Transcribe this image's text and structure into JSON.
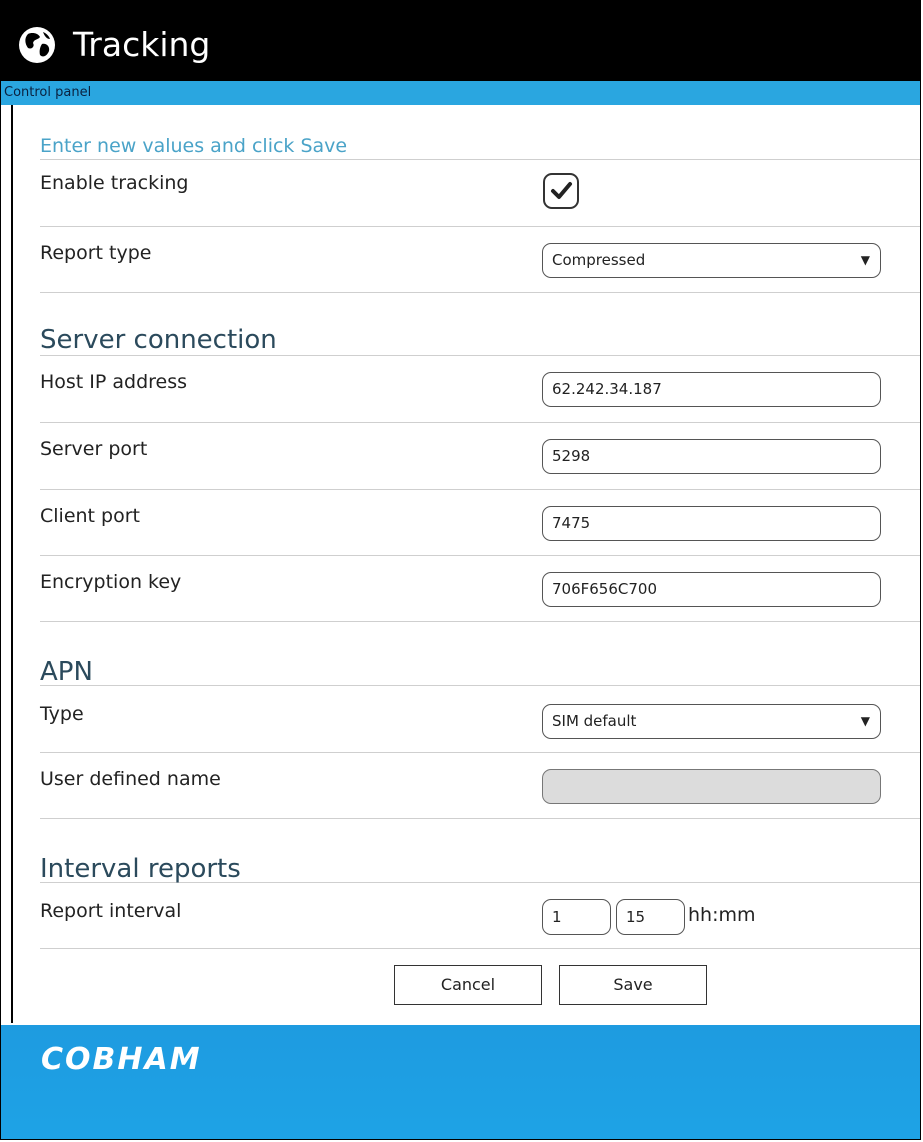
{
  "header": {
    "title": "Tracking",
    "icon": "globe-icon"
  },
  "breadcrumb": "Control panel",
  "form": {
    "intro": "Enter new values and click Save",
    "enable_tracking": {
      "label": "Enable tracking",
      "checked": true
    },
    "report_type": {
      "label": "Report type",
      "value": "Compressed"
    },
    "server_section": "Server connection",
    "host_ip": {
      "label": "Host IP address",
      "value": "62.242.34.187"
    },
    "server_port": {
      "label": "Server port",
      "value": "5298"
    },
    "client_port": {
      "label": "Client port",
      "value": "7475"
    },
    "encryption_key": {
      "label": "Encryption key",
      "value": "706F656C700"
    },
    "apn_section": "APN",
    "apn_type": {
      "label": "Type",
      "value": "SIM default"
    },
    "user_defined_name": {
      "label": "User defined name",
      "value": ""
    },
    "interval_section": "Interval reports",
    "report_interval": {
      "label": "Report interval",
      "hours": "1",
      "minutes": "15",
      "unit": "hh:mm"
    }
  },
  "buttons": {
    "cancel": "Cancel",
    "save": "Save"
  },
  "footer": {
    "logo": "COBHAM"
  },
  "colors": {
    "accent": "#2aa6e0",
    "header_bg": "#000000",
    "section_blue": "#4aa3c8"
  }
}
